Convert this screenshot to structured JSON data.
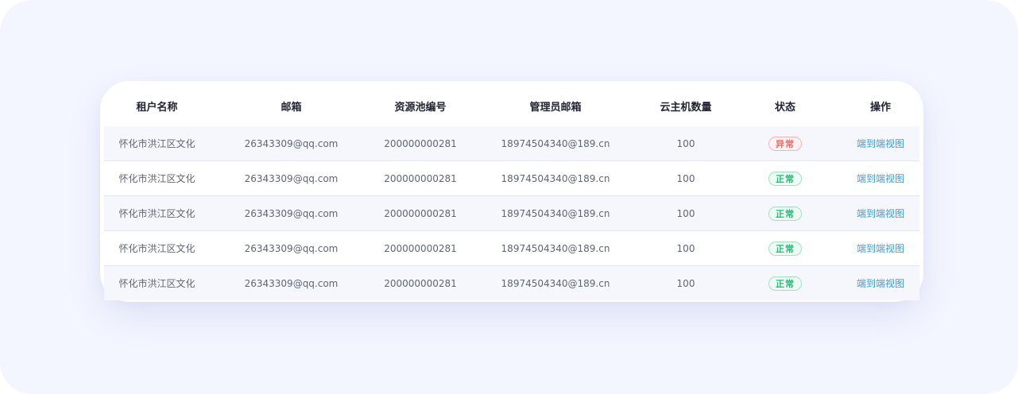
{
  "table": {
    "columns": [
      "租户名称",
      "邮箱",
      "资源池编号",
      "管理员邮箱",
      "云主机数量",
      "状态",
      "操作"
    ],
    "rows": [
      {
        "tenant": "怀化市洪江区文化",
        "email": "26343309@qq.com",
        "pool_id": "200000000281",
        "admin_email": "18974504340@189.cn",
        "vm_count": "100",
        "status": "异常",
        "status_kind": "error",
        "action": "端到端视图"
      },
      {
        "tenant": "怀化市洪江区文化",
        "email": "26343309@qq.com",
        "pool_id": "200000000281",
        "admin_email": "18974504340@189.cn",
        "vm_count": "100",
        "status": "正常",
        "status_kind": "normal",
        "action": "端到端视图"
      },
      {
        "tenant": "怀化市洪江区文化",
        "email": "26343309@qq.com",
        "pool_id": "200000000281",
        "admin_email": "18974504340@189.cn",
        "vm_count": "100",
        "status": "正常",
        "status_kind": "normal",
        "action": "端到端视图"
      },
      {
        "tenant": "怀化市洪江区文化",
        "email": "26343309@qq.com",
        "pool_id": "200000000281",
        "admin_email": "18974504340@189.cn",
        "vm_count": "100",
        "status": "正常",
        "status_kind": "normal",
        "action": "端到端视图"
      },
      {
        "tenant": "怀化市洪江区文化",
        "email": "26343309@qq.com",
        "pool_id": "200000000281",
        "admin_email": "18974504340@189.cn",
        "vm_count": "100",
        "status": "正常",
        "status_kind": "normal",
        "action": "端到端视图"
      }
    ]
  },
  "colors": {
    "page_background": "#f3f6ff",
    "status_error": "#f06a6a",
    "status_normal": "#1dbf77",
    "link": "#2e9ef0"
  }
}
